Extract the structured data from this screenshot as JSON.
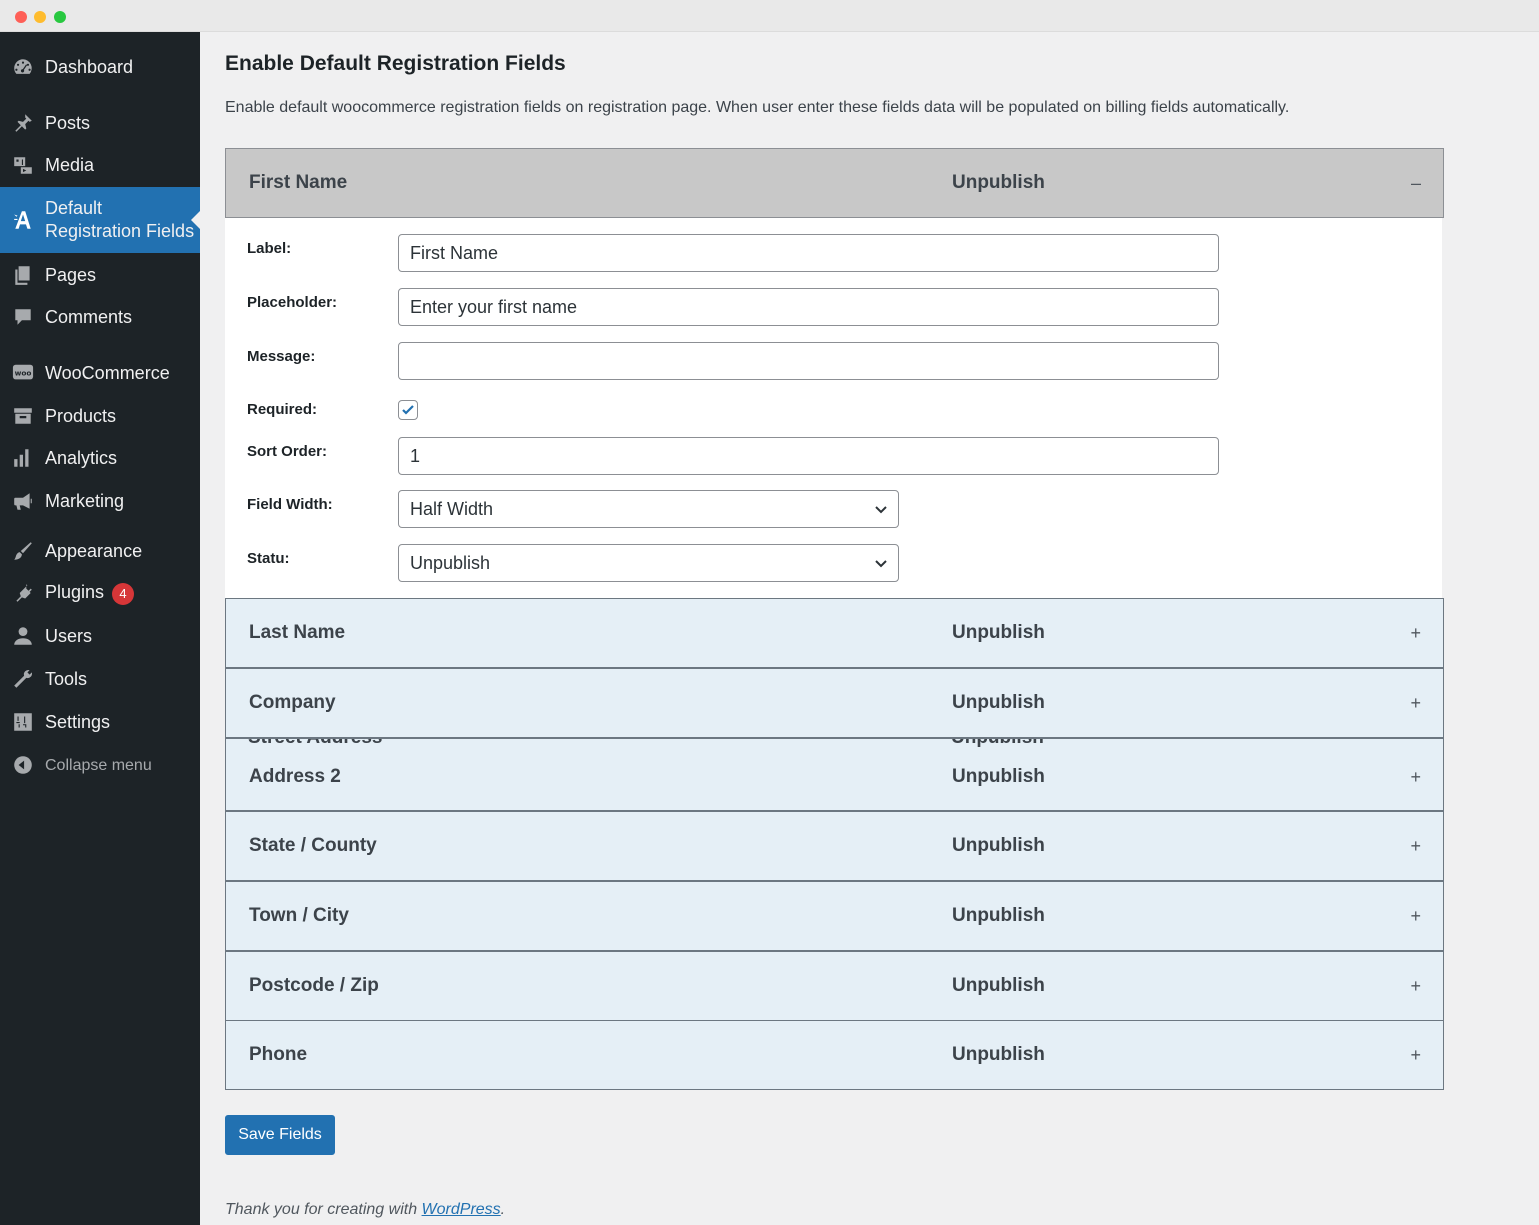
{
  "sidebar": {
    "items": [
      {
        "label": "Dashboard",
        "icon": "dashboard-icon"
      },
      {
        "label": "Posts",
        "icon": "pin-icon"
      },
      {
        "label": "Media",
        "icon": "media-icon"
      },
      {
        "label": "Default Registration Fields",
        "label_line1": "Default",
        "label_line2": "Registration Fields",
        "icon": "plugin-logo-icon",
        "active": true
      },
      {
        "label": "Pages",
        "icon": "pages-icon"
      },
      {
        "label": "Comments",
        "icon": "comment-icon"
      },
      {
        "label": "WooCommerce",
        "icon": "woo-icon",
        "icon_text": "woo"
      },
      {
        "label": "Products",
        "icon": "archive-icon"
      },
      {
        "label": "Analytics",
        "icon": "bar-chart-icon"
      },
      {
        "label": "Marketing",
        "icon": "megaphone-icon"
      },
      {
        "label": "Appearance",
        "icon": "brush-icon"
      },
      {
        "label": "Plugins",
        "icon": "plug-icon",
        "badge": "4"
      },
      {
        "label": "Users",
        "icon": "user-icon"
      },
      {
        "label": "Tools",
        "icon": "wrench-icon"
      },
      {
        "label": "Settings",
        "icon": "settings-icon"
      },
      {
        "label": "Collapse menu",
        "icon": "collapse-arrow-icon"
      }
    ]
  },
  "page": {
    "title": "Enable Default Registration Fields",
    "description": "Enable default woocommerce registration fields on registration page. When user enter these fields data will be populated on billing fields automatically."
  },
  "fields": [
    {
      "name": "First Name",
      "status": "Unpublish",
      "toggle": "–",
      "open": true
    },
    {
      "name": "Last Name",
      "status": "Unpublish",
      "toggle": "+"
    },
    {
      "name": "Company",
      "status": "Unpublish",
      "toggle": "+"
    },
    {
      "name": "Address 2",
      "status": "Unpublish",
      "toggle": "+",
      "overlapped_name": "Street Address",
      "overlapped_status": "Unpublish"
    },
    {
      "name": "State / County",
      "status": "Unpublish",
      "toggle": "+"
    },
    {
      "name": "Town / City",
      "status": "Unpublish",
      "toggle": "+"
    },
    {
      "name": "Postcode / Zip",
      "status": "Unpublish",
      "toggle": "+"
    },
    {
      "name": "Phone",
      "status": "Unpublish",
      "toggle": "+"
    }
  ],
  "form": {
    "label_label": "Label:",
    "label_value": "First Name",
    "placeholder_label": "Placeholder:",
    "placeholder_value": "Enter your first name",
    "message_label": "Message:",
    "message_value": "",
    "required_label": "Required:",
    "required_checked": true,
    "sort_order_label": "Sort Order:",
    "sort_order_value": "1",
    "field_width_label": "Field Width:",
    "field_width_value": "Half Width",
    "status_label": "Statu:",
    "status_value": "Unpublish"
  },
  "actions": {
    "save_label": "Save Fields"
  },
  "footer": {
    "text": "Thank you for creating with ",
    "link": "WordPress",
    "suffix": "."
  },
  "colors": {
    "sidebar_bg": "#1d2327",
    "active_bg": "#2271b1",
    "accordion_bg": "#e5eff6",
    "open_header_bg": "#c8c8c8",
    "badge": "#d63638"
  }
}
